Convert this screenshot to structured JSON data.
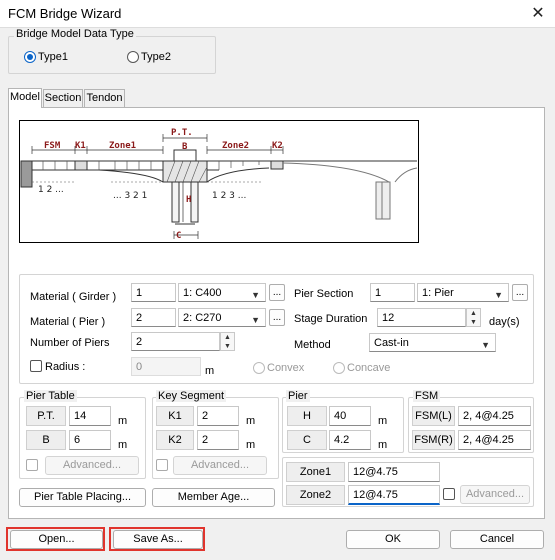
{
  "window": {
    "title": "FCM Bridge Wizard",
    "close_glyph": "✕"
  },
  "data_type": {
    "group_label": "Bridge Model Data Type",
    "type1": "Type1",
    "type2": "Type2",
    "selected": "Type1"
  },
  "tabs": [
    {
      "label": "Model",
      "active": true
    },
    {
      "label": "Section",
      "active": false
    },
    {
      "label": "Tendon",
      "active": false
    }
  ],
  "diagram": {
    "labels": {
      "fsm": "FSM",
      "k1": "K1",
      "zone1": "Zone1",
      "pt": "P.T.",
      "b": "B",
      "zone2": "Zone2",
      "k2": "K2",
      "h": "H",
      "c": "C"
    },
    "left_numbers": "1  2 ...",
    "zone1_numbers": "... 3  2  1",
    "zone2_numbers": "1  2  3 ..."
  },
  "fields": {
    "material_girder": {
      "label": "Material ( Girder )",
      "num": "1",
      "select": "1: C400"
    },
    "material_pier": {
      "label": "Material ( Pier )",
      "num": "2",
      "select": "2: C270"
    },
    "num_piers": {
      "label": "Number of Piers",
      "value": "2"
    },
    "radius": {
      "label": "Radius :",
      "value": "0",
      "unit": "m",
      "convex": "Convex",
      "concave": "Concave"
    },
    "pier_section": {
      "label": "Pier Section",
      "num": "1",
      "select": "1: Pier"
    },
    "stage_duration": {
      "label": "Stage Duration",
      "value": "12",
      "unit": "day(s)"
    },
    "method": {
      "label": "Method",
      "select": "Cast-in"
    },
    "ellipsis": "..."
  },
  "pier_table": {
    "group_label": "Pier Table",
    "pt_label": "P.T.",
    "pt": "14",
    "b_label": "B",
    "b": "6",
    "unit": "m",
    "advanced": "Advanced..."
  },
  "key_segment": {
    "group_label": "Key Segment",
    "k1_label": "K1",
    "k1": "2",
    "k2_label": "K2",
    "k2": "2",
    "unit": "m",
    "advanced": "Advanced..."
  },
  "pier": {
    "group_label": "Pier",
    "h_label": "H",
    "h": "40",
    "c_label": "C",
    "c": "4.2",
    "unit": "m"
  },
  "fsm": {
    "group_label": "FSM",
    "l_label": "FSM(L)",
    "l": "2, 4@4.25",
    "r_label": "FSM(R)",
    "r": "2, 4@4.25"
  },
  "zones": {
    "zone1_label": "Zone1",
    "zone1": "12@4.75",
    "zone2_label": "Zone2",
    "zone2": "12@4.75",
    "advanced": "Advanced..."
  },
  "buttons": {
    "pier_table_placing": "Pier Table Placing...",
    "member_age": "Member Age...",
    "open": "Open...",
    "save_as": "Save As...",
    "ok": "OK",
    "cancel": "Cancel"
  },
  "colors": {
    "label_red": "#8b1a1a",
    "highlight": "#e0342d",
    "accent": "#0a64c8"
  }
}
